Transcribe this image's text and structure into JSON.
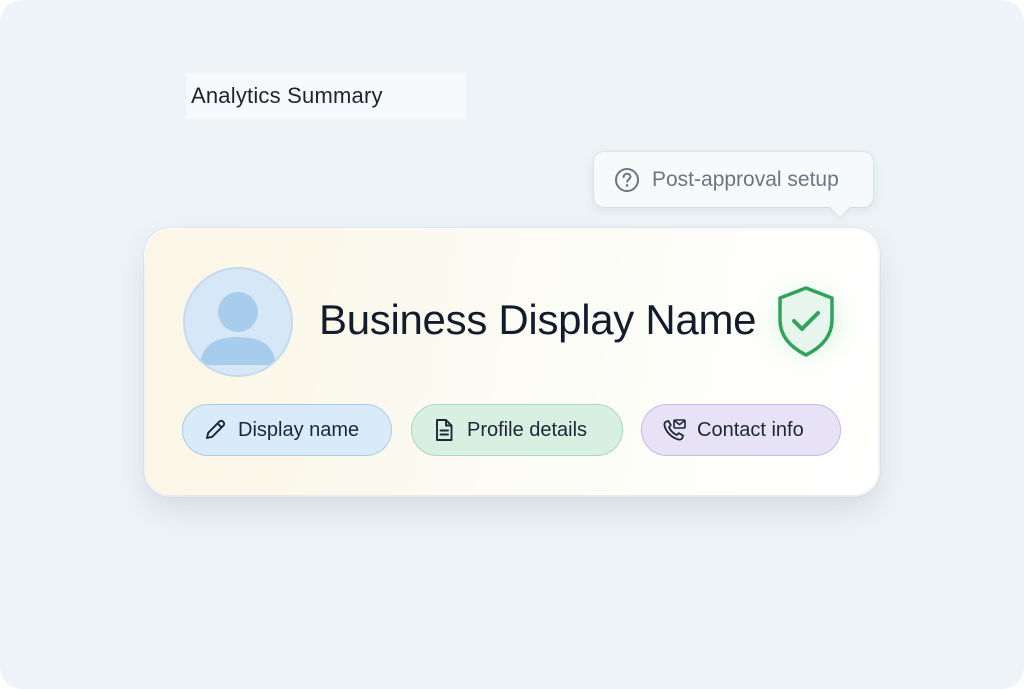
{
  "heading": {
    "text": "Analytics Summary"
  },
  "tooltip": {
    "icon": "question-circle-icon",
    "text": "Post-approval setup"
  },
  "profile_card": {
    "avatar_icon": "user-avatar-icon",
    "business_name": "Business Display Name",
    "verified_icon": "verified-shield-check-icon",
    "verified_color": "#2fa35a"
  },
  "actions": [
    {
      "label": "Display name",
      "icon": "pencil-icon",
      "color": "#d9ebf9"
    },
    {
      "label": "Profile details",
      "icon": "document-icon",
      "color": "#d8f0e1"
    },
    {
      "label": "Contact info",
      "icon": "phone-mail-icon",
      "color": "#e7e2f6"
    }
  ]
}
